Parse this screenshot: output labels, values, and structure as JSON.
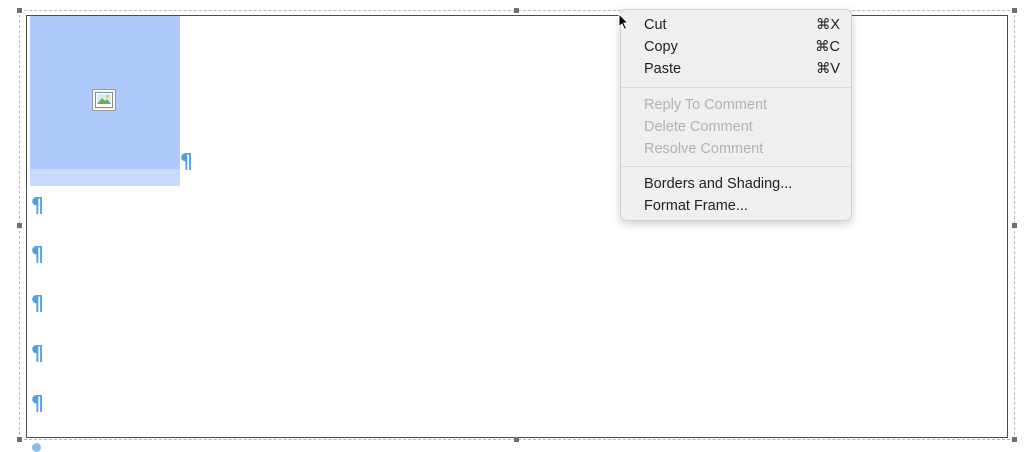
{
  "document": {
    "paragraph_mark": "¶",
    "selection_color": "#aec9fb",
    "mark_color": "#4ea0e6"
  },
  "context_menu": {
    "items": [
      {
        "label": "Cut",
        "shortcut": "⌘X",
        "enabled": true
      },
      {
        "label": "Copy",
        "shortcut": "⌘C",
        "enabled": true
      },
      {
        "label": "Paste",
        "shortcut": "⌘V",
        "enabled": true
      },
      {
        "label": "Reply To Comment",
        "shortcut": "",
        "enabled": false
      },
      {
        "label": "Delete Comment",
        "shortcut": "",
        "enabled": false
      },
      {
        "label": "Resolve Comment",
        "shortcut": "",
        "enabled": false
      },
      {
        "label": "Borders and Shading...",
        "shortcut": "",
        "enabled": true
      },
      {
        "label": "Format Frame...",
        "shortcut": "",
        "enabled": true
      }
    ]
  },
  "icons": {
    "image_placeholder": "image-placeholder-icon",
    "cursor": "arrow-cursor-icon"
  }
}
